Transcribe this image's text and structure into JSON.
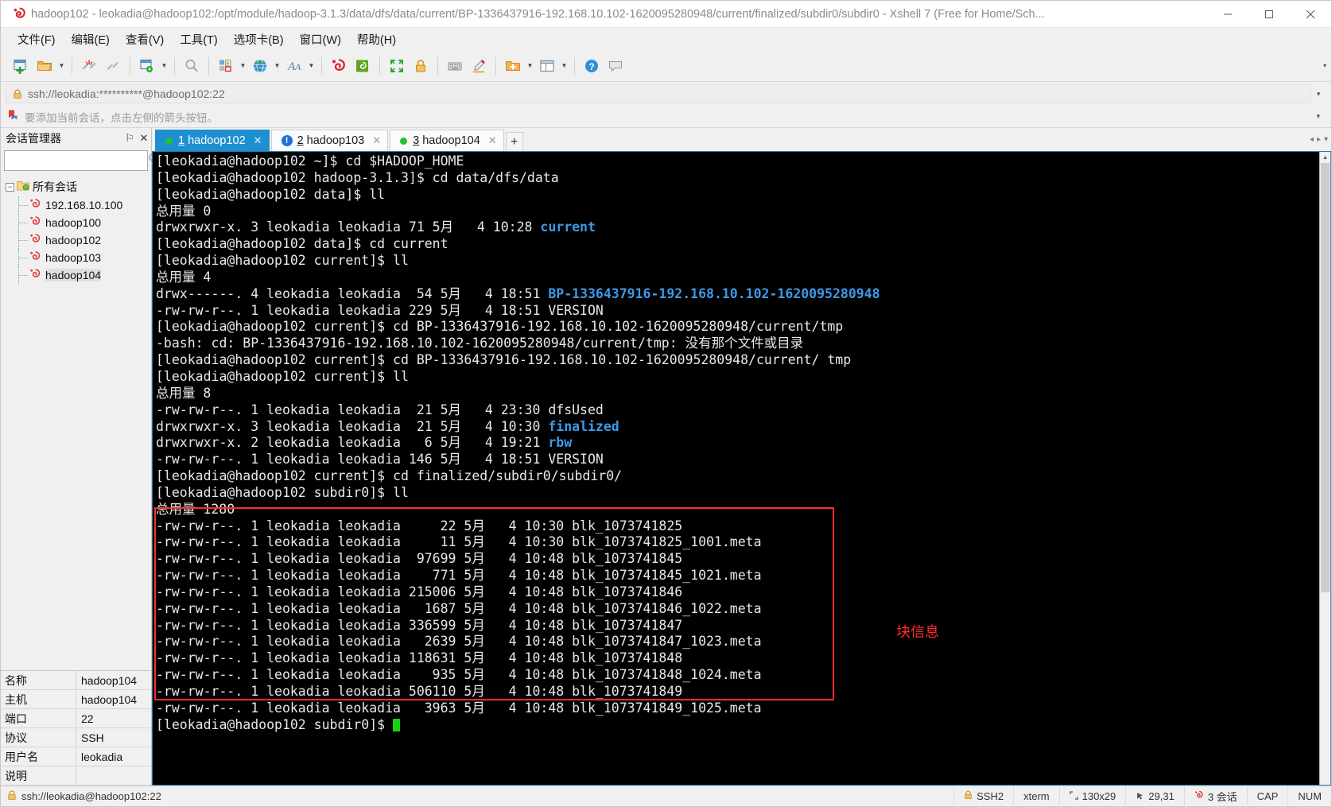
{
  "window": {
    "title": "hadoop102 - leokadia@hadoop102:/opt/module/hadoop-3.1.3/data/dfs/data/current/BP-1336437916-192.168.10.102-1620095280948/current/finalized/subdir0/subdir0 - Xshell 7 (Free for Home/Sch...",
    "minimize": "─",
    "maximize": "□",
    "close": "✕"
  },
  "menubar": [
    {
      "label": "文件(F)"
    },
    {
      "label": "编辑(E)"
    },
    {
      "label": "查看(V)"
    },
    {
      "label": "工具(T)"
    },
    {
      "label": "选项卡(B)"
    },
    {
      "label": "窗口(W)"
    },
    {
      "label": "帮助(H)"
    }
  ],
  "toolbar": {
    "overflow": "▾",
    "items": [
      {
        "name": "new-session-icon",
        "caret": false
      },
      {
        "name": "open-folder-icon",
        "caret": true
      },
      {
        "name": "sep1",
        "caret": false
      },
      {
        "name": "disconnect-icon",
        "caret": false
      },
      {
        "name": "reconnect-icon",
        "caret": false
      },
      {
        "name": "sep2",
        "caret": false
      },
      {
        "name": "session-properties-icon",
        "caret": true
      },
      {
        "name": "sep3",
        "caret": false
      },
      {
        "name": "find-icon",
        "caret": false
      },
      {
        "name": "sep4",
        "caret": false
      },
      {
        "name": "layout-icon",
        "caret": true
      },
      {
        "name": "globe-icon",
        "caret": true
      },
      {
        "name": "font-icon",
        "caret": true
      },
      {
        "name": "sep5",
        "caret": false
      },
      {
        "name": "xshell-icon",
        "caret": false
      },
      {
        "name": "xftp-icon",
        "caret": false
      },
      {
        "name": "sep6",
        "caret": false
      },
      {
        "name": "fullscreen-icon",
        "caret": false
      },
      {
        "name": "lock-icon",
        "caret": false
      },
      {
        "name": "sep7",
        "caret": false
      },
      {
        "name": "keyboard-icon",
        "caret": false
      },
      {
        "name": "highlight-icon",
        "caret": false
      },
      {
        "name": "sep8",
        "caret": false
      },
      {
        "name": "new-folder-icon",
        "caret": true
      },
      {
        "name": "split-view-icon",
        "caret": true
      },
      {
        "name": "sep9",
        "caret": false
      },
      {
        "name": "help-icon",
        "caret": false
      },
      {
        "name": "comment-icon",
        "caret": false
      }
    ]
  },
  "addressbar": {
    "value": "ssh://leokadia:**********@hadoop102:22",
    "placeholder": "ssh://",
    "caret": "▾"
  },
  "notice": {
    "text": "要添加当前会话，点击左侧的箭头按钮。",
    "caret": "▾"
  },
  "session_manager": {
    "title": "会话管理器",
    "pin": "⚐",
    "close": "✕",
    "search_value": "",
    "search_placeholder": "",
    "search_icon": "search-icon",
    "tree": {
      "toggle": "−",
      "root": "所有会话",
      "children": [
        {
          "label": "192.168.10.100",
          "selected": false
        },
        {
          "label": "hadoop100",
          "selected": false
        },
        {
          "label": "hadoop102",
          "selected": false
        },
        {
          "label": "hadoop103",
          "selected": false
        },
        {
          "label": "hadoop104",
          "selected": true
        }
      ]
    },
    "properties": [
      {
        "key": "名称",
        "value": "hadoop104"
      },
      {
        "key": "主机",
        "value": "hadoop104"
      },
      {
        "key": "端口",
        "value": "22"
      },
      {
        "key": "协议",
        "value": "SSH"
      },
      {
        "key": "用户名",
        "value": "leokadia"
      },
      {
        "key": "说明",
        "value": ""
      }
    ]
  },
  "tabs": {
    "items": [
      {
        "num": "1",
        "label": "hadoop102",
        "active": true,
        "status": "dot",
        "close": "✕"
      },
      {
        "num": "2",
        "label": "hadoop103",
        "active": false,
        "status": "warn",
        "close": "✕"
      },
      {
        "num": "3",
        "label": "hadoop104",
        "active": false,
        "status": "dot",
        "close": "✕"
      }
    ],
    "add": "+",
    "nav_prev": "◂",
    "nav_next": "▸",
    "nav_list": "▾"
  },
  "terminal": {
    "annotation": "块信息",
    "cursor": "",
    "lines": [
      [
        {
          "t": "[leokadia@hadoop102 ~]$ cd $HADOOP_HOME",
          "c": "w"
        }
      ],
      [
        {
          "t": "[leokadia@hadoop102 hadoop-3.1.3]$ cd data/dfs/data",
          "c": "w"
        }
      ],
      [
        {
          "t": "[leokadia@hadoop102 data]$ ll",
          "c": "w"
        }
      ],
      [
        {
          "t": "总用量 0",
          "c": "w"
        }
      ],
      [
        {
          "t": "drwxrwxr-x. 3 leokadia leokadia 71 5月   4 10:28 ",
          "c": "w"
        },
        {
          "t": "current",
          "c": "d"
        }
      ],
      [
        {
          "t": "[leokadia@hadoop102 data]$ cd current",
          "c": "w"
        }
      ],
      [
        {
          "t": "[leokadia@hadoop102 current]$ ll",
          "c": "w"
        }
      ],
      [
        {
          "t": "总用量 4",
          "c": "w"
        }
      ],
      [
        {
          "t": "drwx------. 4 leokadia leokadia  54 5月   4 18:51 ",
          "c": "w"
        },
        {
          "t": "BP-1336437916-192.168.10.102-1620095280948",
          "c": "d"
        }
      ],
      [
        {
          "t": "-rw-rw-r--. 1 leokadia leokadia 229 5月   4 18:51 VERSION",
          "c": "w"
        }
      ],
      [
        {
          "t": "[leokadia@hadoop102 current]$ cd BP-1336437916-192.168.10.102-1620095280948/current/tmp",
          "c": "w"
        }
      ],
      [
        {
          "t": "-bash: cd: BP-1336437916-192.168.10.102-1620095280948/current/tmp: 没有那个文件或目录",
          "c": "w"
        }
      ],
      [
        {
          "t": "[leokadia@hadoop102 current]$ cd BP-1336437916-192.168.10.102-1620095280948/current/ tmp",
          "c": "w"
        }
      ],
      [
        {
          "t": "[leokadia@hadoop102 current]$ ll",
          "c": "w"
        }
      ],
      [
        {
          "t": "总用量 8",
          "c": "w"
        }
      ],
      [
        {
          "t": "-rw-rw-r--. 1 leokadia leokadia  21 5月   4 23:30 dfsUsed",
          "c": "w"
        }
      ],
      [
        {
          "t": "drwxrwxr-x. 3 leokadia leokadia  21 5月   4 10:30 ",
          "c": "w"
        },
        {
          "t": "finalized",
          "c": "d"
        }
      ],
      [
        {
          "t": "drwxrwxr-x. 2 leokadia leokadia   6 5月   4 19:21 ",
          "c": "w"
        },
        {
          "t": "rbw",
          "c": "d"
        }
      ],
      [
        {
          "t": "-rw-rw-r--. 1 leokadia leokadia 146 5月   4 18:51 VERSION",
          "c": "w"
        }
      ],
      [
        {
          "t": "[leokadia@hadoop102 current]$ cd finalized/subdir0/subdir0/",
          "c": "w"
        }
      ],
      [
        {
          "t": "[leokadia@hadoop102 subdir0]$ ll",
          "c": "w"
        }
      ],
      [
        {
          "t": "总用量 1280",
          "c": "w"
        }
      ],
      [
        {
          "t": "-rw-rw-r--. 1 leokadia leokadia     22 5月   4 10:30 blk_1073741825",
          "c": "w"
        }
      ],
      [
        {
          "t": "-rw-rw-r--. 1 leokadia leokadia     11 5月   4 10:30 blk_1073741825_1001.meta",
          "c": "w"
        }
      ],
      [
        {
          "t": "-rw-rw-r--. 1 leokadia leokadia  97699 5月   4 10:48 blk_1073741845",
          "c": "w"
        }
      ],
      [
        {
          "t": "-rw-rw-r--. 1 leokadia leokadia    771 5月   4 10:48 blk_1073741845_1021.meta",
          "c": "w"
        }
      ],
      [
        {
          "t": "-rw-rw-r--. 1 leokadia leokadia 215006 5月   4 10:48 blk_1073741846",
          "c": "w"
        }
      ],
      [
        {
          "t": "-rw-rw-r--. 1 leokadia leokadia   1687 5月   4 10:48 blk_1073741846_1022.meta",
          "c": "w"
        }
      ],
      [
        {
          "t": "-rw-rw-r--. 1 leokadia leokadia 336599 5月   4 10:48 blk_1073741847",
          "c": "w"
        }
      ],
      [
        {
          "t": "-rw-rw-r--. 1 leokadia leokadia   2639 5月   4 10:48 blk_1073741847_1023.meta",
          "c": "w"
        }
      ],
      [
        {
          "t": "-rw-rw-r--. 1 leokadia leokadia 118631 5月   4 10:48 blk_1073741848",
          "c": "w"
        }
      ],
      [
        {
          "t": "-rw-rw-r--. 1 leokadia leokadia    935 5月   4 10:48 blk_1073741848_1024.meta",
          "c": "w"
        }
      ],
      [
        {
          "t": "-rw-rw-r--. 1 leokadia leokadia 506110 5月   4 10:48 blk_1073741849",
          "c": "w"
        }
      ],
      [
        {
          "t": "-rw-rw-r--. 1 leokadia leokadia   3963 5月   4 10:48 blk_1073741849_1025.meta",
          "c": "w"
        }
      ],
      [
        {
          "t": "[leokadia@hadoop102 subdir0]$ ",
          "c": "w"
        }
      ]
    ]
  },
  "statusbar": {
    "connection": "ssh://leokadia@hadoop102:22",
    "cells": [
      {
        "icon": "lock-icon",
        "label": "SSH2"
      },
      {
        "icon": "",
        "label": "xterm"
      },
      {
        "icon": "size-icon",
        "label": "130x29"
      },
      {
        "icon": "caret-icon",
        "label": "29,31"
      },
      {
        "icon": "sessions-icon",
        "label": "3 会话"
      },
      {
        "icon": "",
        "label": "CAP"
      },
      {
        "icon": "",
        "label": "NUM"
      }
    ]
  },
  "colors": {
    "accent": "#1e90d2",
    "dir_blue": "#3d9ae8",
    "annotation_red": "#ff2b2b",
    "terminal_bg": "#000000",
    "terminal_fg": "#e6e6e6"
  }
}
